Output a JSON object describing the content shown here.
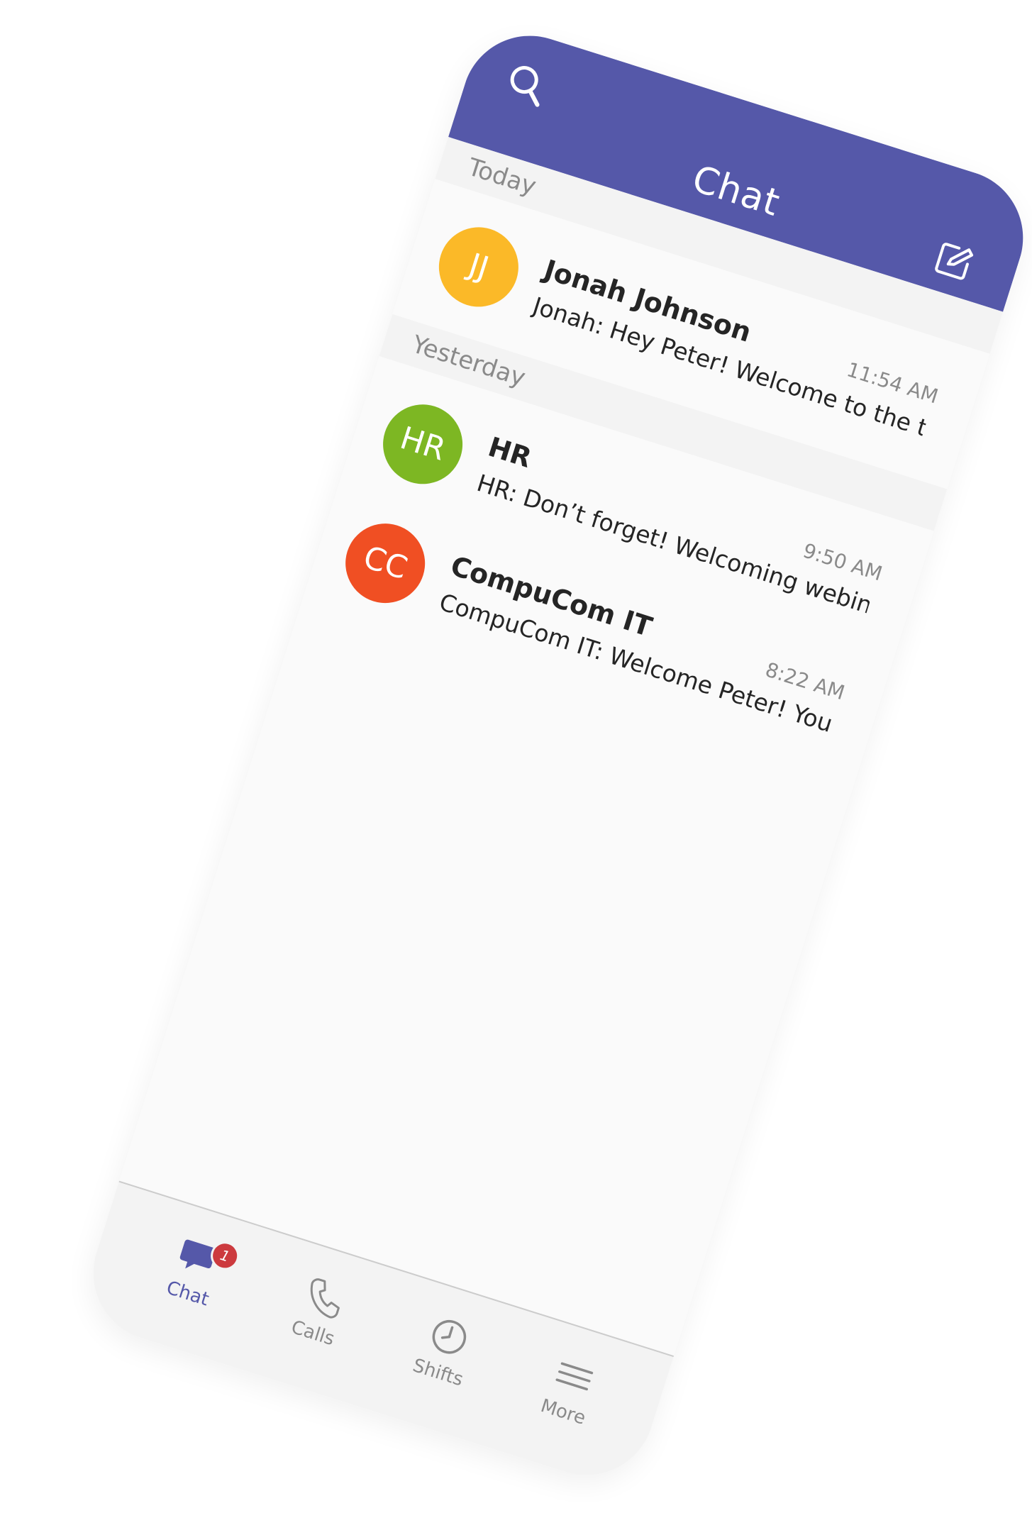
{
  "header": {
    "title": "Chat",
    "search_icon": "search-icon",
    "compose_icon": "compose-icon",
    "color": "#5558a9"
  },
  "sections": [
    {
      "label": "Today",
      "chats": [
        {
          "initials": "JJ",
          "avatar_color": "#fbb928",
          "name": "Jonah Johnson",
          "preview": "Jonah: Hey Peter! Welcome to the team!",
          "time": "11:54 AM"
        }
      ]
    },
    {
      "label": "Yesterday",
      "chats": [
        {
          "initials": "HR",
          "avatar_color": "#7db723",
          "name": "HR",
          "preview": "HR: Don’t forget! Welcoming webinar a...",
          "time": "9:50 AM"
        },
        {
          "initials": "CC",
          "avatar_color": "#f04f23",
          "name": "CompuCom IT",
          "preview": "CompuCom IT: Welcome Peter! You get...",
          "time": "8:22 AM"
        }
      ]
    }
  ],
  "nav": {
    "items": [
      {
        "label": "Chat",
        "icon": "chat-bubble-icon",
        "active": true,
        "badge": "1"
      },
      {
        "label": "Calls",
        "icon": "phone-icon",
        "active": false
      },
      {
        "label": "Shifts",
        "icon": "clock-icon",
        "active": false
      },
      {
        "label": "More",
        "icon": "menu-icon",
        "active": false
      }
    ]
  }
}
